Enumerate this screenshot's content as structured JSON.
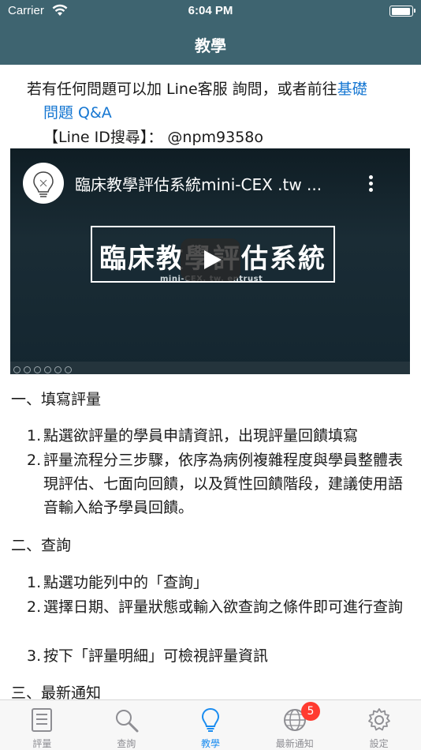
{
  "status_bar": {
    "carrier": "Carrier",
    "time": "6:04 PM"
  },
  "nav": {
    "title": "教學"
  },
  "intro": {
    "text_before_link": "若有任何問題可以加 Line客服 詢問，或者前往",
    "link_part1": "基礎",
    "link_part2": "問題 Q&A",
    "line_id": "【Line ID搜尋】： @npm9358o"
  },
  "video": {
    "title": "臨床教學評估系統mini-CEX .tw ...",
    "banner": "臨床教學評估系統",
    "subtitle": "mini-CEX. tw. entrust"
  },
  "sections": [
    {
      "heading": "一、填寫評量",
      "items": [
        {
          "num": "1.",
          "text": "點選欲評量的學員申請資訊，出現評量回饋填寫"
        },
        {
          "num": "2.",
          "text": "評量流程分三步驟，依序為病例複雜程度與學員整體表現評估、七面向回饋，以及質性回饋階段，建議使用語音輸入給予學員回饋。"
        }
      ]
    },
    {
      "heading": "二、查詢",
      "items": [
        {
          "num": "1.",
          "text": "點選功能列中的「查詢」"
        },
        {
          "num": "2.",
          "text": "選擇日期、評量狀態或輸入欲查詢之條件即可進行查詢"
        },
        {
          "num": "3.",
          "text": "按下「評量明細」可檢視評量資訊"
        }
      ]
    },
    {
      "heading": "三、最新通知"
    }
  ],
  "tabs": [
    {
      "label": "評量",
      "icon": "list-icon"
    },
    {
      "label": "查詢",
      "icon": "search-icon"
    },
    {
      "label": "教學",
      "icon": "lightbulb-icon"
    },
    {
      "label": "最新通知",
      "icon": "globe-icon"
    },
    {
      "label": "設定",
      "icon": "gear-icon"
    }
  ],
  "badge": "5",
  "colors": {
    "header": "#3e6470",
    "accent": "#1a8cf0",
    "link": "#1677d2",
    "badge": "#ff3b30"
  }
}
